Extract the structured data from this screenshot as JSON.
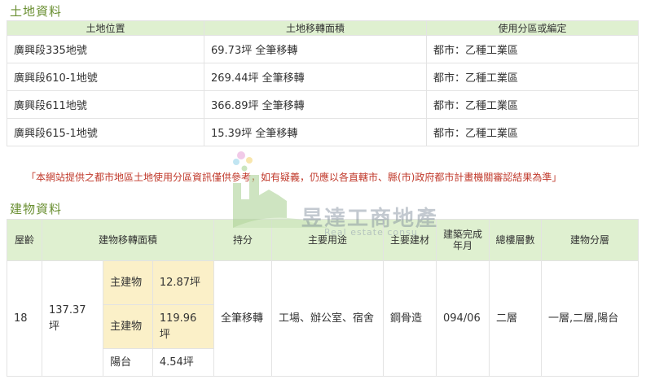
{
  "land_section": {
    "title": "土地資料",
    "headers": [
      "土地位置",
      "土地移轉面積",
      "使用分區或編定"
    ],
    "rows": [
      {
        "location": "廣興段335地號",
        "area": "69.73坪 全筆移轉",
        "zoning": "都市：乙種工業區"
      },
      {
        "location": "廣興段610-1地號",
        "area": "269.44坪 全筆移轉",
        "zoning": "都市：乙種工業區"
      },
      {
        "location": "廣興段611地號",
        "area": "366.89坪 全筆移轉",
        "zoning": "都市：乙種工業區"
      },
      {
        "location": "廣興段615-1地號",
        "area": "15.39坪 全筆移轉",
        "zoning": "都市：乙種工業區"
      }
    ]
  },
  "notice": "「本網站提供之都市地區土地使用分區資訊僅供參考，如有疑義，仍應以各直轄市、縣(市)政府都市計畫機關審認結果為準」",
  "watermark": {
    "name": "昱達工商地產",
    "subtitle": "Real estate consu"
  },
  "building_section": {
    "title": "建物資料",
    "headers": {
      "age": "屋齡",
      "area": "建物移轉面積",
      "share": "持分",
      "usage": "主要用途",
      "material": "主要建材",
      "completed": "建築完成年月",
      "floors": "總樓層數",
      "floor_levels": "建物分層"
    },
    "row": {
      "age": "18",
      "total_area": "137.37坪",
      "sub_areas": [
        {
          "label": "主建物",
          "value": "12.87坪"
        },
        {
          "label": "主建物",
          "value": "119.96坪"
        },
        {
          "label": "陽台",
          "value": "4.54坪"
        }
      ],
      "share": "全筆移轉",
      "usage": "工場、辦公室、宿舍",
      "material": "鋼骨造",
      "completed": "094/06",
      "floors": "二層",
      "floor_levels": "一層,二層,陽台"
    }
  },
  "colors": {
    "header_bg": "#dff0d0",
    "title_green": "#6a8f32",
    "notice_red": "#c0392b",
    "highlight_yellow": "#fbf0c8"
  }
}
